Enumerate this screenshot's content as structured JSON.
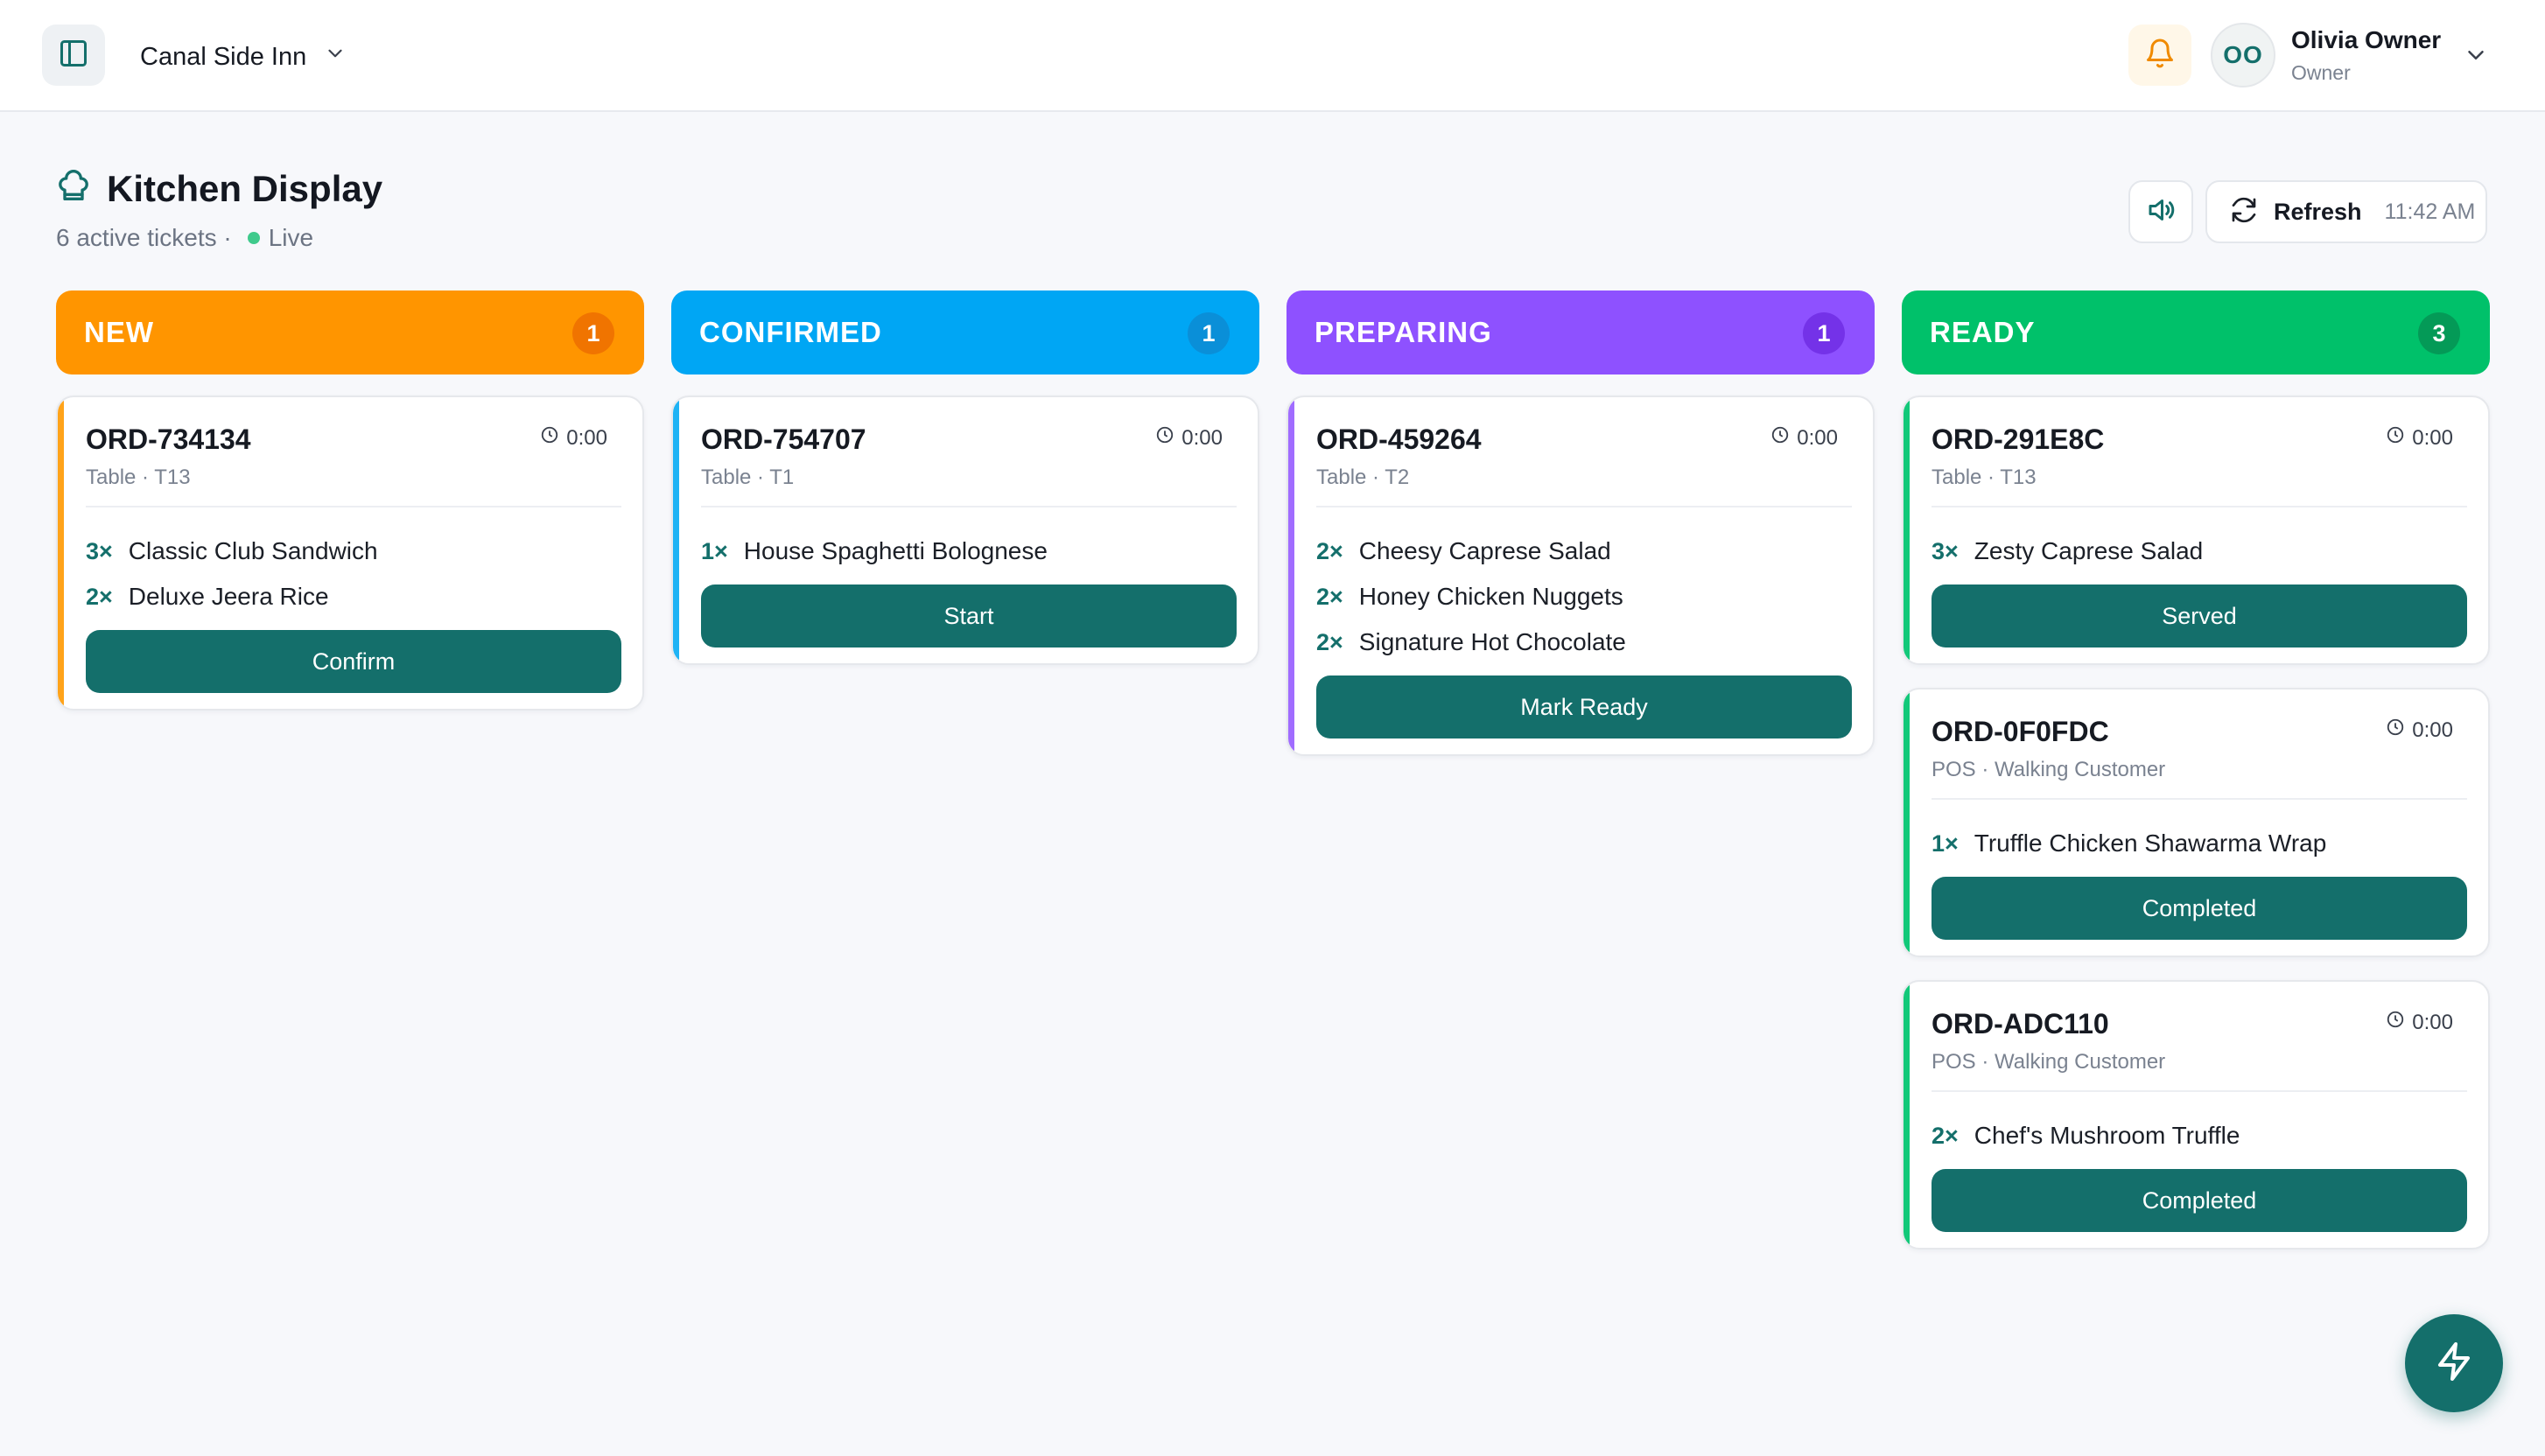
{
  "header": {
    "venue_name": "Canal Side Inn",
    "user": {
      "initials": "OO",
      "name": "Olivia Owner",
      "role": "Owner"
    }
  },
  "page": {
    "title": "Kitchen Display",
    "active_tickets": "6 active tickets ·",
    "live_label": "Live",
    "refresh_label": "Refresh",
    "refresh_time": "11:42 AM"
  },
  "colors": {
    "brand": "#146f6b",
    "new": "#ff9500",
    "confirmed": "#00a6f4",
    "preparing": "#8e51ff",
    "ready": "#00c16a"
  },
  "columns": [
    {
      "title": "NEW",
      "count": "1",
      "tickets": [
        {
          "id": "ORD-734134",
          "timer": "0:00",
          "meta": "Table · T13",
          "items": [
            {
              "qty": "3×",
              "name": "Classic Club Sandwich"
            },
            {
              "qty": "2×",
              "name": "Deluxe Jeera Rice"
            }
          ],
          "action": "Confirm"
        }
      ]
    },
    {
      "title": "CONFIRMED",
      "count": "1",
      "tickets": [
        {
          "id": "ORD-754707",
          "timer": "0:00",
          "meta": "Table · T1",
          "items": [
            {
              "qty": "1×",
              "name": "House Spaghetti Bolognese"
            }
          ],
          "action": "Start"
        }
      ]
    },
    {
      "title": "PREPARING",
      "count": "1",
      "tickets": [
        {
          "id": "ORD-459264",
          "timer": "0:00",
          "meta": "Table · T2",
          "items": [
            {
              "qty": "2×",
              "name": "Cheesy Caprese Salad"
            },
            {
              "qty": "2×",
              "name": "Honey Chicken Nuggets"
            },
            {
              "qty": "2×",
              "name": "Signature Hot Chocolate"
            }
          ],
          "action": "Mark Ready"
        }
      ]
    },
    {
      "title": "READY",
      "count": "3",
      "tickets": [
        {
          "id": "ORD-291E8C",
          "timer": "0:00",
          "meta": "Table · T13",
          "items": [
            {
              "qty": "3×",
              "name": "Zesty Caprese Salad"
            }
          ],
          "action": "Served"
        },
        {
          "id": "ORD-0F0FDC",
          "timer": "0:00",
          "meta": "POS · Walking Customer",
          "items": [
            {
              "qty": "1×",
              "name": "Truffle Chicken Shawarma Wrap"
            }
          ],
          "action": "Completed"
        },
        {
          "id": "ORD-ADC110",
          "timer": "0:00",
          "meta": "POS · Walking Customer",
          "items": [
            {
              "qty": "2×",
              "name": "Chef's Mushroom Truffle"
            }
          ],
          "action": "Completed"
        }
      ]
    }
  ]
}
